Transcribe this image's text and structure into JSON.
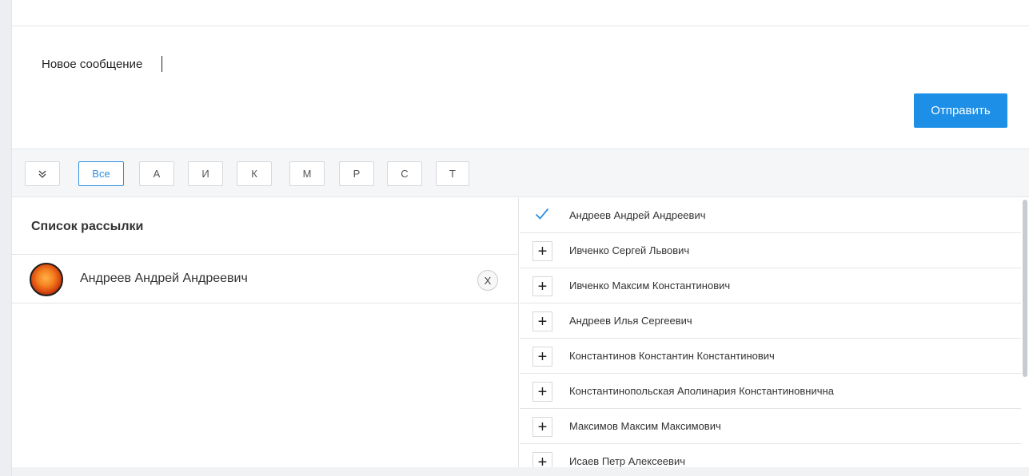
{
  "composer": {
    "message_text": "Новое сообщение",
    "send_label": "Отправить"
  },
  "filters": {
    "collapse_icon": "double-chevron-down-icon",
    "letters": [
      "Все",
      "А",
      "И",
      "К",
      "М",
      "Р",
      "С",
      "Т"
    ],
    "active": "Все"
  },
  "mailing_list": {
    "title": "Список рассылки",
    "items": [
      {
        "name": "Андреев Андрей Андреевич",
        "avatar": "sun-avatar",
        "remove_label": "X"
      }
    ]
  },
  "contacts": {
    "items": [
      {
        "name": "Андреев Андрей Андреевич",
        "selected": true
      },
      {
        "name": "Ивченко Сергей Львович",
        "selected": false
      },
      {
        "name": "Ивченко Максим Константинович",
        "selected": false
      },
      {
        "name": "Андреев Илья Сергеевич",
        "selected": false
      },
      {
        "name": "Константинов Константин Константинович",
        "selected": false
      },
      {
        "name": "Константинопольская Аполинария Константиновнична",
        "selected": false
      },
      {
        "name": "Максимов Максим Максимович",
        "selected": false
      },
      {
        "name": "Исаев Петр Алексеевич",
        "selected": false
      }
    ],
    "add_symbol": "+"
  },
  "colors": {
    "accent": "#1e8fe6",
    "check": "#2f8fe0"
  }
}
